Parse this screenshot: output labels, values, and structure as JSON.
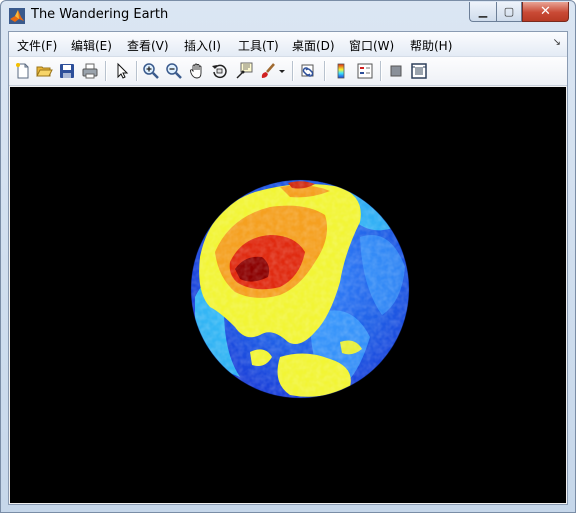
{
  "window": {
    "title": "The Wandering Earth",
    "caption": {
      "minimize": "▁",
      "maximize": "▢",
      "close": "✕"
    }
  },
  "menu": {
    "items": [
      "文件(F)",
      "编辑(E)",
      "查看(V)",
      "插入(I)",
      "工具(T)",
      "桌面(D)",
      "窗口(W)",
      "帮助(H)"
    ],
    "overflow_icon": "double-chevron-icon"
  },
  "toolbar": {
    "icons": [
      "new-figure-icon",
      "open-file-icon",
      "save-icon",
      "print-icon",
      "select-arrow-icon",
      "zoom-in-icon",
      "zoom-out-icon",
      "pan-hand-icon",
      "rotate-3d-icon",
      "data-cursor-icon",
      "brush-icon",
      "brush-dropdown-icon",
      "link-plot-icon",
      "colorbar-icon",
      "legend-icon",
      "hide-plot-tools-icon",
      "show-plot-tools-icon"
    ]
  },
  "figure": {
    "background": "#000000",
    "colors": {
      "ocean_deep": "#1a3cd8",
      "ocean_light": "#3fa4ff",
      "cyan": "#3ee6ff",
      "yellow": "#f2f535",
      "orange": "#f5a020",
      "red": "#e02a10",
      "dark_red": "#8c0000"
    }
  }
}
